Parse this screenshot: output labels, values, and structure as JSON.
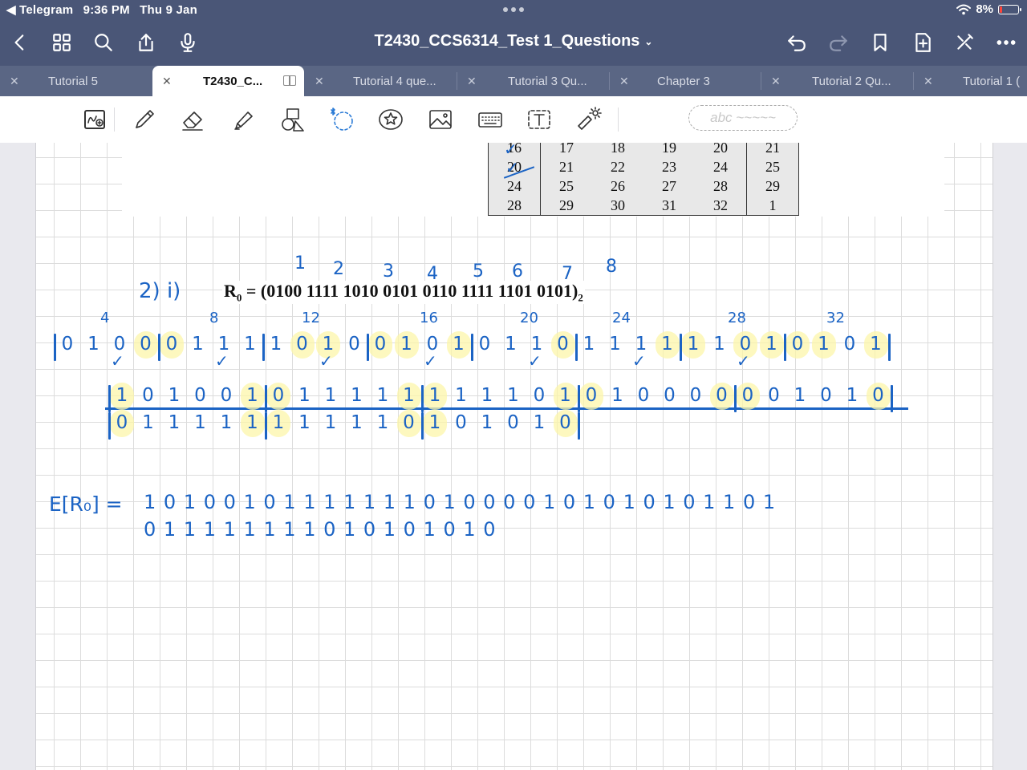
{
  "status": {
    "back_app": "◀ Telegram",
    "time": "9:36 PM",
    "date": "Thu 9 Jan",
    "battery": "8%",
    "battery_level": 0.08
  },
  "nav": {
    "title": "T2430_CCS6314_Test 1_Questions",
    "buttons": [
      "back-icon",
      "grid-icon",
      "search-icon",
      "share-icon",
      "microphone-icon",
      "undo-icon",
      "redo-icon",
      "bookmark-icon",
      "add-page-icon",
      "close-icon",
      "more-icon"
    ]
  },
  "tabs": [
    {
      "label": "Tutorial 5",
      "active": false
    },
    {
      "label": "T2430_C...",
      "active": true
    },
    {
      "label": "Tutorial 4 que...",
      "active": false
    },
    {
      "label": "Tutorial 3 Qu...",
      "active": false
    },
    {
      "label": "Chapter 3",
      "active": false
    },
    {
      "label": "Tutorial 2 Qu...",
      "active": false
    },
    {
      "label": "Tutorial 1 (",
      "active": false
    }
  ],
  "toolbar": {
    "tools": [
      "lasso-image-icon",
      "pen-icon",
      "eraser-icon",
      "highlighter-icon",
      "shapes-icon",
      "bluetooth-lasso-icon",
      "sticker-icon",
      "image-icon",
      "keyboard-icon",
      "text-box-icon",
      "laser-pointer-icon"
    ],
    "text_style_preview": "abc ~~~~~"
  },
  "document": {
    "expansion_table": [
      [
        "16",
        "17",
        "18",
        "19",
        "20",
        "21"
      ],
      [
        "20",
        "21",
        "22",
        "23",
        "24",
        "25"
      ],
      [
        "24",
        "25",
        "26",
        "27",
        "28",
        "29"
      ],
      [
        "28",
        "29",
        "30",
        "31",
        "32",
        "1"
      ]
    ],
    "r0_label": "R",
    "r0_sub": "0",
    "r0_value": " = (0100  1111  1010  0101  0110  1111  1101  0101)",
    "r0_base": "2",
    "group_numbers": [
      "1",
      "2",
      "3",
      "4",
      "5",
      "6",
      "7",
      "8"
    ],
    "question_label": "2) i)",
    "position_marks": [
      "4",
      "8",
      "12",
      "16",
      "20",
      "24",
      "28",
      "32"
    ],
    "r0_bits_handwritten": "01000111101001010110111111010101",
    "expanded_row1": "101001011111111101010000001010101011001",
    "expanded_row2": "01111111111010101010",
    "e_label": "E[R₀] =",
    "e_line1": "1 0 1 0 0 1   0 1 1 1 1 1   1 1 0 1 0 0   0 0 1 0 1 0   1 0 1 0 1 1 0 1",
    "e_line2": "0 1 1 1 1 1   1 1 1 0 1 0   1 0 1 0 1 0"
  }
}
